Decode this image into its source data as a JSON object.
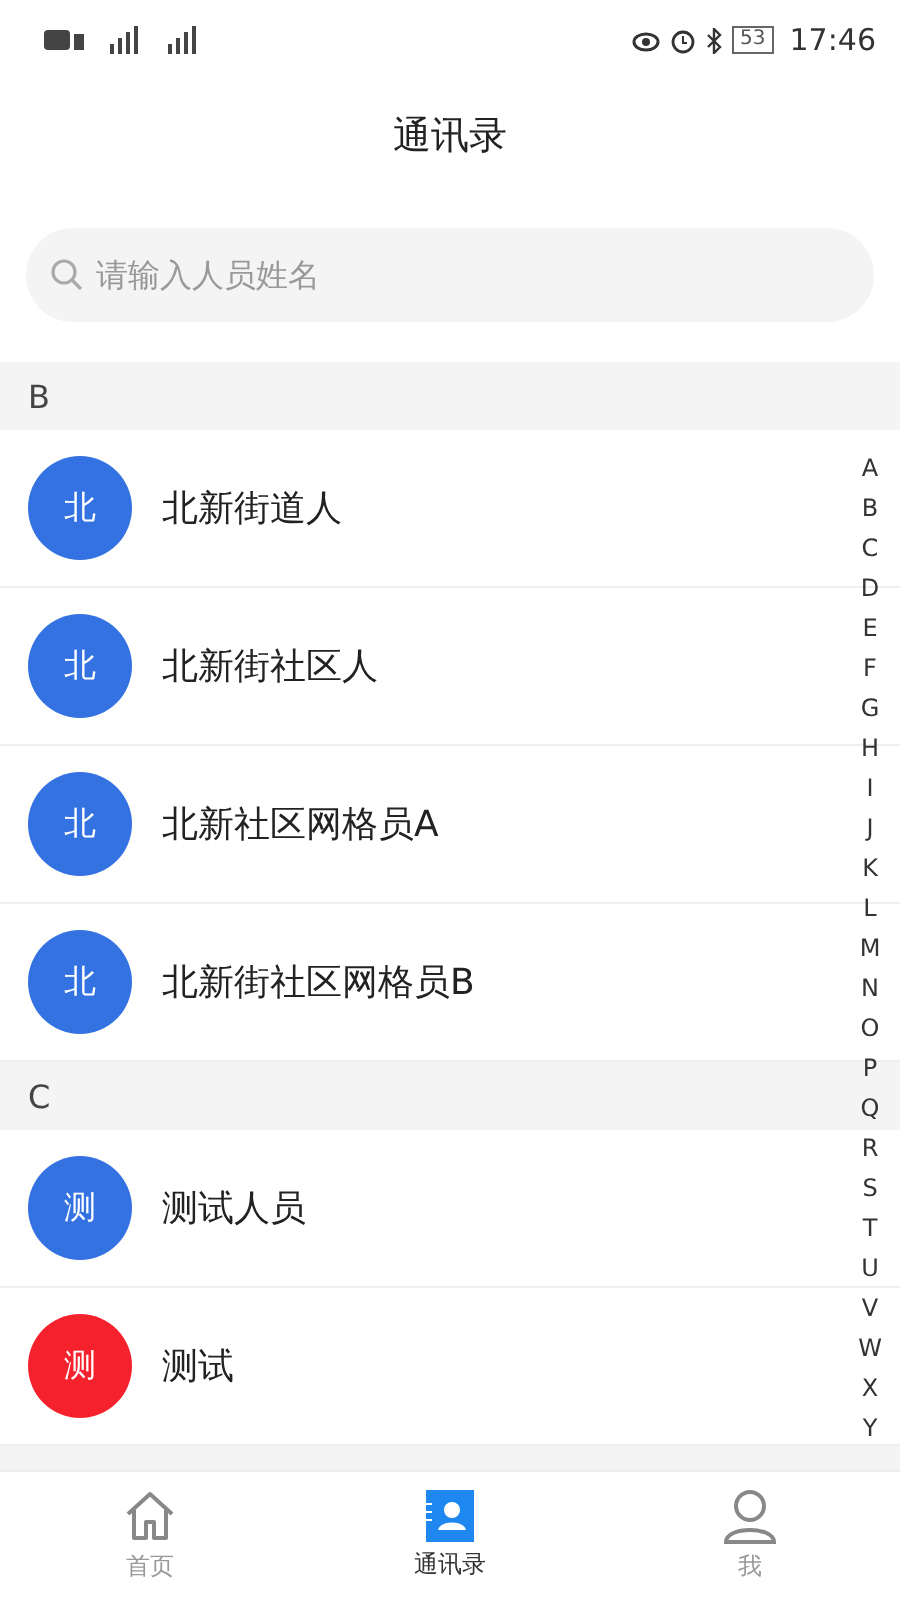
{
  "status_bar": {
    "time": "17:46",
    "battery": "53"
  },
  "title": "通讯录",
  "search": {
    "placeholder": "请输入人员姓名"
  },
  "sections": [
    {
      "letter": "B",
      "contacts": [
        {
          "avatar": "北",
          "name": "北新街道人",
          "color": "#3372e0"
        },
        {
          "avatar": "北",
          "name": "北新街社区人",
          "color": "#3372e0"
        },
        {
          "avatar": "北",
          "name": "北新社区网格员A",
          "color": "#3372e0"
        },
        {
          "avatar": "北",
          "name": "北新街社区网格员B",
          "color": "#3372e0"
        }
      ]
    },
    {
      "letter": "C",
      "contacts": [
        {
          "avatar": "测",
          "name": "测试人员",
          "color": "#3372e0"
        },
        {
          "avatar": "测",
          "name": "测试",
          "color": "#f5222d"
        }
      ]
    }
  ],
  "index_letters": [
    "A",
    "B",
    "C",
    "D",
    "E",
    "F",
    "G",
    "H",
    "I",
    "J",
    "K",
    "L",
    "M",
    "N",
    "O",
    "P",
    "Q",
    "R",
    "S",
    "T",
    "U",
    "V",
    "W",
    "X",
    "Y"
  ],
  "nav": [
    {
      "kind": "home",
      "label": "首页",
      "selected": false
    },
    {
      "kind": "contacts",
      "label": "通讯录",
      "selected": true
    },
    {
      "kind": "me",
      "label": "我",
      "selected": false
    }
  ]
}
